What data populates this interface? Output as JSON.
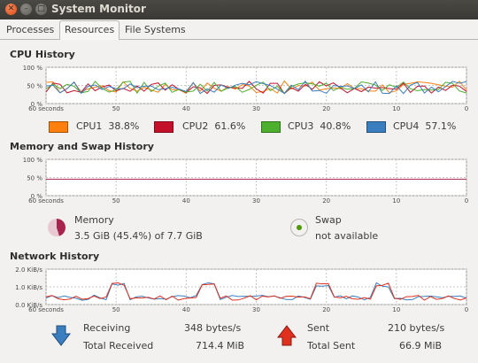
{
  "window": {
    "title": "System Monitor"
  },
  "tabs": [
    {
      "label": "Processes",
      "active": false
    },
    {
      "label": "Resources",
      "active": true
    },
    {
      "label": "File Systems",
      "active": false
    }
  ],
  "cpu": {
    "title": "CPU History",
    "y_ticks": [
      "100 %",
      "50 %",
      "0 %"
    ],
    "x_ticks": [
      "60 seconds",
      "50",
      "40",
      "30",
      "20",
      "10",
      "0"
    ],
    "legend": [
      {
        "name": "CPU1",
        "value": "38.8%",
        "color": "#ff7f0e"
      },
      {
        "name": "CPU2",
        "value": "61.6%",
        "color": "#c5102c"
      },
      {
        "name": "CPU3",
        "value": "40.8%",
        "color": "#4caf2d"
      },
      {
        "name": "CPU4",
        "value": "57.1%",
        "color": "#3a7ebf"
      }
    ]
  },
  "memory": {
    "title": "Memory and Swap History",
    "y_ticks": [
      "100 %",
      "50 %",
      "0 %"
    ],
    "x_ticks": [
      "60 seconds",
      "50",
      "40",
      "30",
      "20",
      "10",
      "0"
    ],
    "memory_label": "Memory",
    "memory_value": "3.5 GiB (45.4%) of 7.7 GiB",
    "memory_color": "#a8244f",
    "memory_fraction": 0.454,
    "swap_label": "Swap",
    "swap_value": "not available",
    "swap_color": "#4e9a06"
  },
  "network": {
    "title": "Network History",
    "y_ticks": [
      "2.0 KiB/s",
      "1.0 KiB/s",
      "0.0 KiB/s"
    ],
    "x_ticks": [
      "60 seconds",
      "50",
      "40",
      "30",
      "20",
      "10",
      "0"
    ],
    "receiving_label": "Receiving",
    "receiving_value": "348 bytes/s",
    "total_received_label": "Total Received",
    "total_received_value": "714.4 MiB",
    "sent_label": "Sent",
    "sent_value": "210 bytes/s",
    "total_sent_label": "Total Sent",
    "total_sent_value": "66.9 MiB",
    "receive_color": "#3a7ebf",
    "sent_color": "#e0301e"
  }
}
